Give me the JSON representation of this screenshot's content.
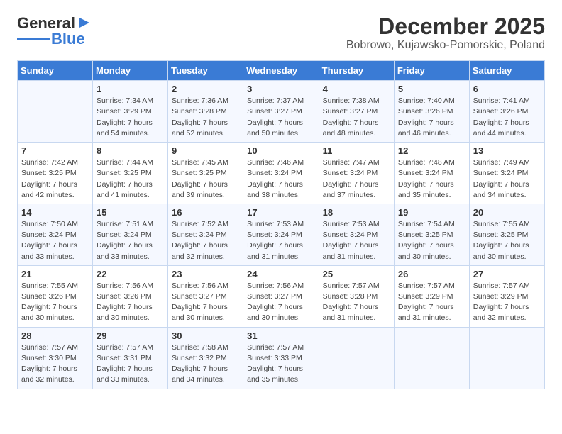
{
  "header": {
    "logo": {
      "line1": "General",
      "line2": "Blue"
    },
    "title": "December 2025",
    "subtitle": "Bobrowo, Kujawsko-Pomorskie, Poland"
  },
  "weekdays": [
    "Sunday",
    "Monday",
    "Tuesday",
    "Wednesday",
    "Thursday",
    "Friday",
    "Saturday"
  ],
  "weeks": [
    [
      {
        "day": "",
        "sunrise": "",
        "sunset": "",
        "daylight": ""
      },
      {
        "day": "1",
        "sunrise": "Sunrise: 7:34 AM",
        "sunset": "Sunset: 3:29 PM",
        "daylight": "Daylight: 7 hours and 54 minutes."
      },
      {
        "day": "2",
        "sunrise": "Sunrise: 7:36 AM",
        "sunset": "Sunset: 3:28 PM",
        "daylight": "Daylight: 7 hours and 52 minutes."
      },
      {
        "day": "3",
        "sunrise": "Sunrise: 7:37 AM",
        "sunset": "Sunset: 3:27 PM",
        "daylight": "Daylight: 7 hours and 50 minutes."
      },
      {
        "day": "4",
        "sunrise": "Sunrise: 7:38 AM",
        "sunset": "Sunset: 3:27 PM",
        "daylight": "Daylight: 7 hours and 48 minutes."
      },
      {
        "day": "5",
        "sunrise": "Sunrise: 7:40 AM",
        "sunset": "Sunset: 3:26 PM",
        "daylight": "Daylight: 7 hours and 46 minutes."
      },
      {
        "day": "6",
        "sunrise": "Sunrise: 7:41 AM",
        "sunset": "Sunset: 3:26 PM",
        "daylight": "Daylight: 7 hours and 44 minutes."
      }
    ],
    [
      {
        "day": "7",
        "sunrise": "Sunrise: 7:42 AM",
        "sunset": "Sunset: 3:25 PM",
        "daylight": "Daylight: 7 hours and 42 minutes."
      },
      {
        "day": "8",
        "sunrise": "Sunrise: 7:44 AM",
        "sunset": "Sunset: 3:25 PM",
        "daylight": "Daylight: 7 hours and 41 minutes."
      },
      {
        "day": "9",
        "sunrise": "Sunrise: 7:45 AM",
        "sunset": "Sunset: 3:25 PM",
        "daylight": "Daylight: 7 hours and 39 minutes."
      },
      {
        "day": "10",
        "sunrise": "Sunrise: 7:46 AM",
        "sunset": "Sunset: 3:24 PM",
        "daylight": "Daylight: 7 hours and 38 minutes."
      },
      {
        "day": "11",
        "sunrise": "Sunrise: 7:47 AM",
        "sunset": "Sunset: 3:24 PM",
        "daylight": "Daylight: 7 hours and 37 minutes."
      },
      {
        "day": "12",
        "sunrise": "Sunrise: 7:48 AM",
        "sunset": "Sunset: 3:24 PM",
        "daylight": "Daylight: 7 hours and 35 minutes."
      },
      {
        "day": "13",
        "sunrise": "Sunrise: 7:49 AM",
        "sunset": "Sunset: 3:24 PM",
        "daylight": "Daylight: 7 hours and 34 minutes."
      }
    ],
    [
      {
        "day": "14",
        "sunrise": "Sunrise: 7:50 AM",
        "sunset": "Sunset: 3:24 PM",
        "daylight": "Daylight: 7 hours and 33 minutes."
      },
      {
        "day": "15",
        "sunrise": "Sunrise: 7:51 AM",
        "sunset": "Sunset: 3:24 PM",
        "daylight": "Daylight: 7 hours and 33 minutes."
      },
      {
        "day": "16",
        "sunrise": "Sunrise: 7:52 AM",
        "sunset": "Sunset: 3:24 PM",
        "daylight": "Daylight: 7 hours and 32 minutes."
      },
      {
        "day": "17",
        "sunrise": "Sunrise: 7:53 AM",
        "sunset": "Sunset: 3:24 PM",
        "daylight": "Daylight: 7 hours and 31 minutes."
      },
      {
        "day": "18",
        "sunrise": "Sunrise: 7:53 AM",
        "sunset": "Sunset: 3:24 PM",
        "daylight": "Daylight: 7 hours and 31 minutes."
      },
      {
        "day": "19",
        "sunrise": "Sunrise: 7:54 AM",
        "sunset": "Sunset: 3:25 PM",
        "daylight": "Daylight: 7 hours and 30 minutes."
      },
      {
        "day": "20",
        "sunrise": "Sunrise: 7:55 AM",
        "sunset": "Sunset: 3:25 PM",
        "daylight": "Daylight: 7 hours and 30 minutes."
      }
    ],
    [
      {
        "day": "21",
        "sunrise": "Sunrise: 7:55 AM",
        "sunset": "Sunset: 3:26 PM",
        "daylight": "Daylight: 7 hours and 30 minutes."
      },
      {
        "day": "22",
        "sunrise": "Sunrise: 7:56 AM",
        "sunset": "Sunset: 3:26 PM",
        "daylight": "Daylight: 7 hours and 30 minutes."
      },
      {
        "day": "23",
        "sunrise": "Sunrise: 7:56 AM",
        "sunset": "Sunset: 3:27 PM",
        "daylight": "Daylight: 7 hours and 30 minutes."
      },
      {
        "day": "24",
        "sunrise": "Sunrise: 7:56 AM",
        "sunset": "Sunset: 3:27 PM",
        "daylight": "Daylight: 7 hours and 30 minutes."
      },
      {
        "day": "25",
        "sunrise": "Sunrise: 7:57 AM",
        "sunset": "Sunset: 3:28 PM",
        "daylight": "Daylight: 7 hours and 31 minutes."
      },
      {
        "day": "26",
        "sunrise": "Sunrise: 7:57 AM",
        "sunset": "Sunset: 3:29 PM",
        "daylight": "Daylight: 7 hours and 31 minutes."
      },
      {
        "day": "27",
        "sunrise": "Sunrise: 7:57 AM",
        "sunset": "Sunset: 3:29 PM",
        "daylight": "Daylight: 7 hours and 32 minutes."
      }
    ],
    [
      {
        "day": "28",
        "sunrise": "Sunrise: 7:57 AM",
        "sunset": "Sunset: 3:30 PM",
        "daylight": "Daylight: 7 hours and 32 minutes."
      },
      {
        "day": "29",
        "sunrise": "Sunrise: 7:57 AM",
        "sunset": "Sunset: 3:31 PM",
        "daylight": "Daylight: 7 hours and 33 minutes."
      },
      {
        "day": "30",
        "sunrise": "Sunrise: 7:58 AM",
        "sunset": "Sunset: 3:32 PM",
        "daylight": "Daylight: 7 hours and 34 minutes."
      },
      {
        "day": "31",
        "sunrise": "Sunrise: 7:57 AM",
        "sunset": "Sunset: 3:33 PM",
        "daylight": "Daylight: 7 hours and 35 minutes."
      },
      {
        "day": "",
        "sunrise": "",
        "sunset": "",
        "daylight": ""
      },
      {
        "day": "",
        "sunrise": "",
        "sunset": "",
        "daylight": ""
      },
      {
        "day": "",
        "sunrise": "",
        "sunset": "",
        "daylight": ""
      }
    ]
  ]
}
